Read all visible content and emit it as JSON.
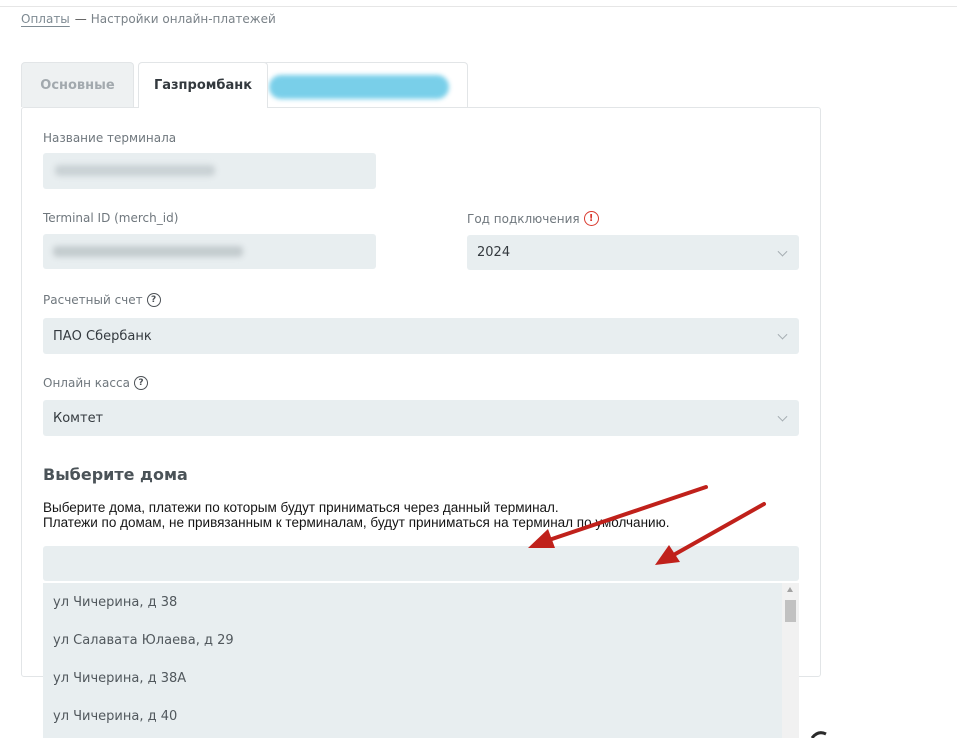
{
  "breadcrumb": {
    "link": "Оплаты",
    "separator": "—",
    "current": "Настройки онлайн-платежей"
  },
  "tabs": [
    {
      "label": "Основные",
      "active": false
    },
    {
      "label": "Газпромбанк",
      "active": true
    },
    {
      "label": "",
      "active": false,
      "blurred": true
    }
  ],
  "form": {
    "terminal_name": {
      "label": "Название терминала",
      "value": ""
    },
    "terminal_id": {
      "label": "Terminal ID (merch_id)",
      "value": ""
    },
    "year": {
      "label": "Год подключения",
      "value": "2024",
      "icon": "alert-icon"
    },
    "account": {
      "label": "Расчетный счет",
      "value": "ПАО Сбербанк",
      "icon": "help-icon"
    },
    "cashbox": {
      "label": "Онлайн касса",
      "value": "Комтет",
      "icon": "help-icon"
    }
  },
  "houses": {
    "title": "Выберите дома",
    "description_line1": "Выберите дома, платежи по которым будут приниматься через данный терминал.",
    "description_line2": "Платежи по домам, не привязанным к терминалам, будут приниматься на терминал по умолчанию.",
    "search_value": "",
    "items": [
      "ул Чичерина, д 38",
      "ул Салавата Юлаева, д 29",
      "ул Чичерина, д 38А",
      "ул Чичерина, д 40"
    ]
  },
  "colors": {
    "field_bg": "#e8eef0",
    "arrow": "#c0211b",
    "alert": "#d93a2f",
    "blurred_tab": "#62c7e6"
  }
}
